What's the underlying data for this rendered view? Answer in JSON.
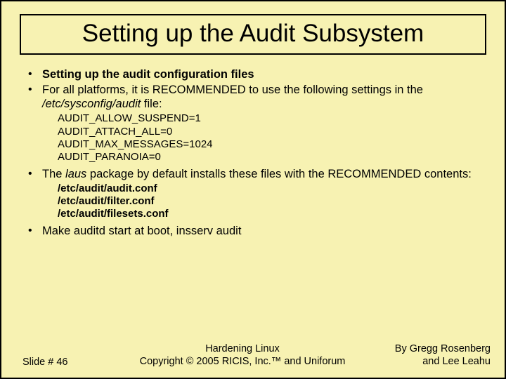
{
  "title": "Setting up the Audit Subsystem",
  "bullets": {
    "b1": "Setting up the audit configuration files",
    "b2_pre": "For all platforms, it is RECOMMENDED to use the following settings in the ",
    "b2_file": "/etc/sysconfig/audit",
    "b2_post": " file:",
    "settings": [
      "AUDIT_ALLOW_SUSPEND=1",
      "AUDIT_ATTACH_ALL=0",
      "AUDIT_MAX_MESSAGES=1024",
      "AUDIT_PARANOIA=0"
    ],
    "b3_pre": "The ",
    "b3_pkg": "laus",
    "b3_post": " package by default installs these files with the RECOMMENDED contents:",
    "files": [
      "/etc/audit/audit.conf",
      "/etc/audit/filter.conf",
      "/etc/audit/filesets.conf"
    ],
    "b4": "Make auditd start at boot, insserv audit"
  },
  "footer": {
    "slide": "Slide # 46",
    "center1": "Hardening Linux",
    "center2": "Copyright © 2005 RICIS, Inc.™ and Uniforum",
    "right1": "By Gregg Rosenberg",
    "right2": "and Lee Leahu"
  }
}
